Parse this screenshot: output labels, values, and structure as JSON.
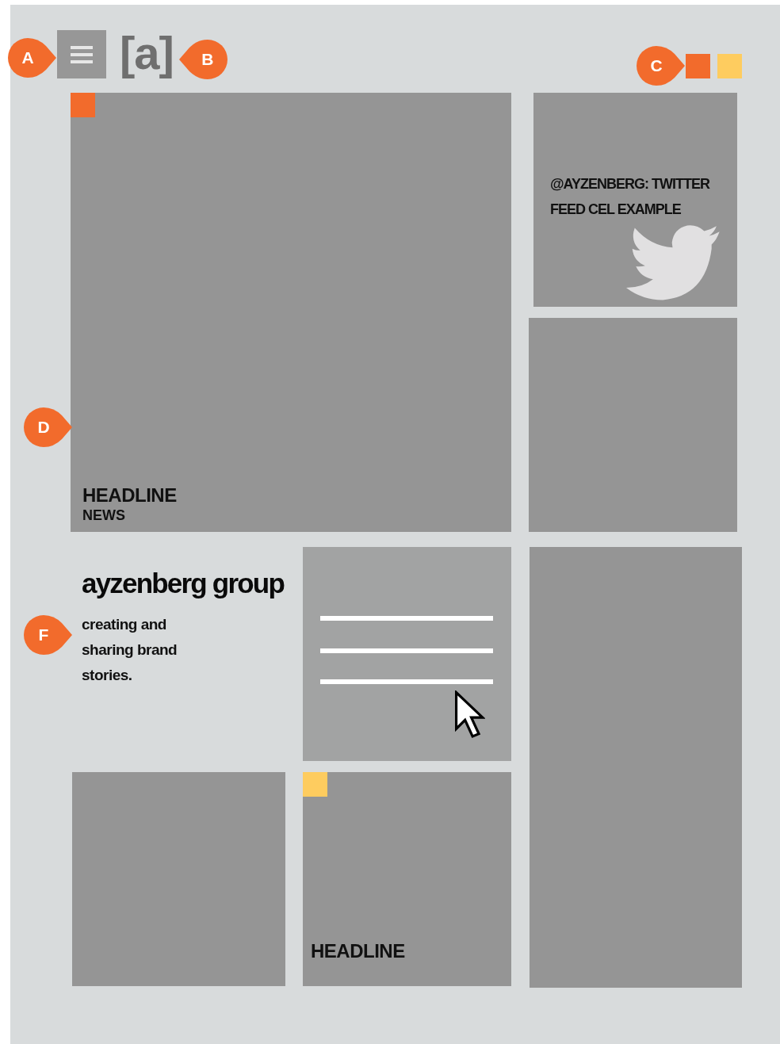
{
  "header": {
    "menu_annotation": "A",
    "logo": "[a]",
    "logo_annotation": "B",
    "swatch_annotation": "C",
    "swatches": [
      {
        "color": "#f26b2c"
      },
      {
        "color": "#fecc5f"
      }
    ]
  },
  "feature": {
    "tag": {
      "color": "#f26b2c"
    },
    "headline": "HEADLINE",
    "category": "NEWS",
    "annotation": "D"
  },
  "twitter": {
    "text": "@AYZENBERG: TWITTER FEED CEL EXAMPLE"
  },
  "intro": {
    "title": "ayzenberg group",
    "tagline": "creating and sharing brand stories.",
    "annotation": "F"
  },
  "story": {
    "tag": {
      "color": "#fecc5f"
    },
    "headline": "HEADLINE"
  }
}
